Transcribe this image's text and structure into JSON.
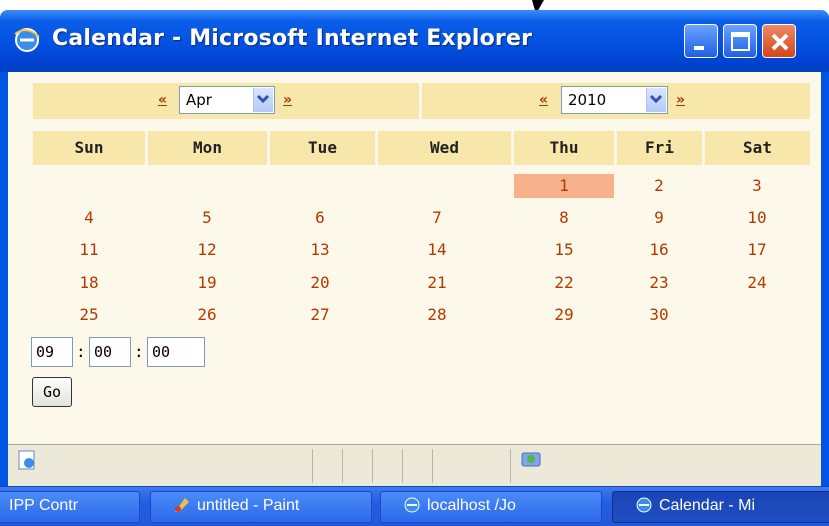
{
  "window": {
    "title": "Calendar - Microsoft Internet Explorer"
  },
  "nav": {
    "prev_month_label": "«",
    "next_month_label": "»",
    "month_value": "Apr",
    "prev_year_label": "«",
    "next_year_label": "»",
    "year_value": "2010"
  },
  "weekdays": [
    "Sun",
    "Mon",
    "Tue",
    "Wed",
    "Thu",
    "Fri",
    "Sat"
  ],
  "days": [
    [
      "",
      "",
      "",
      "",
      "1",
      "2",
      "3"
    ],
    [
      "4",
      "5",
      "6",
      "7",
      "8",
      "9",
      "10"
    ],
    [
      "11",
      "12",
      "13",
      "14",
      "15",
      "16",
      "17"
    ],
    [
      "18",
      "19",
      "20",
      "21",
      "22",
      "23",
      "24"
    ],
    [
      "25",
      "26",
      "27",
      "28",
      "29",
      "30",
      ""
    ]
  ],
  "selected_day": "1",
  "time": {
    "hour": "09",
    "minute": "00",
    "second": "00",
    "separator": ":",
    "go_label": "Go"
  },
  "taskbar": {
    "items": [
      {
        "label": "IPP Contr",
        "icon": ""
      },
      {
        "label": "untitled - Paint",
        "icon": "paint-icon"
      },
      {
        "label": "localhost /Jo",
        "icon": "ie-icon"
      },
      {
        "label": "Calendar - Mi",
        "icon": "ie-icon"
      }
    ]
  },
  "colors": {
    "titlebar": "#0054e3",
    "content_bg": "#fdf9ea",
    "header_bg": "#f8e7ab",
    "day_text": "#b23a00",
    "today_bg": "#f7b18b",
    "taskbar": "#245de0"
  }
}
